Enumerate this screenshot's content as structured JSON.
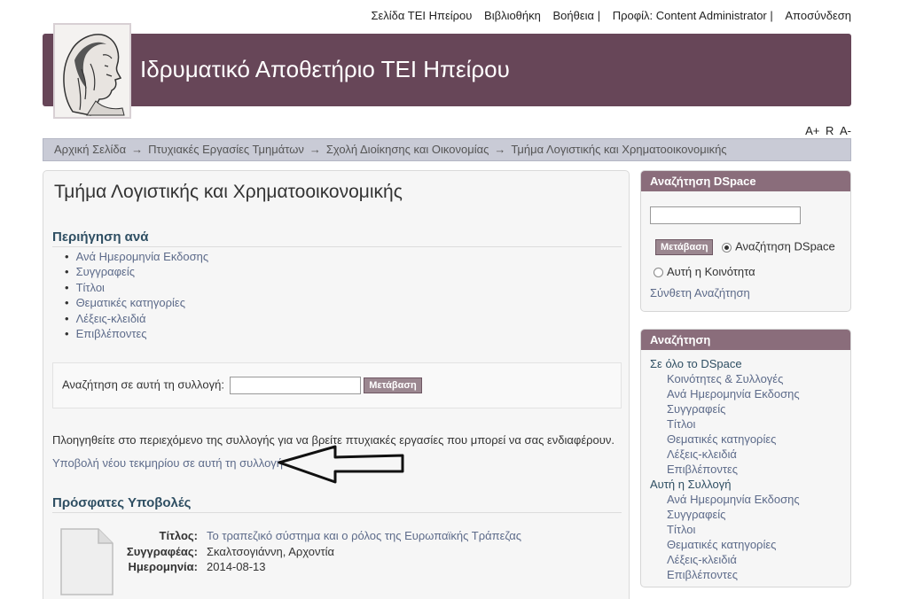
{
  "topnav": {
    "home": "Σελίδα ΤΕΙ Ηπείρου",
    "library": "Βιβλιοθήκη",
    "help": "Βοήθεια |",
    "profile": "Προφίλ: Content Administrator |",
    "logout": "Αποσύνδεση"
  },
  "banner": {
    "title": "Ιδρυματικό Αποθετήριο ΤΕΙ Ηπείρου"
  },
  "font_size": {
    "increase": "A+",
    "reset": "R",
    "decrease": "A-"
  },
  "breadcrumb": {
    "items": [
      "Αρχική Σελίδα",
      "Πτυχιακές Εργασίες Τμημάτων",
      "Σχολή Διοίκησης και Οικονομίας",
      "Τμήμα Λογιστικής και Χρηματοοικονομικής"
    ],
    "separator": "→"
  },
  "main": {
    "title": "Τμήμα Λογιστικής και Χρηματοοικονομικής",
    "browse_heading": "Περιήγηση ανά",
    "browse_items": [
      "Ανά Ημερομηνία Εκδοσης",
      "Συγγραφείς",
      "Τίτλοι",
      "Θεματικές κατηγορίες",
      "Λέξεις-κλειδιά",
      "Επιβλέποντες"
    ],
    "collection_search_label": "Αναζήτηση σε αυτή τη συλλογή:",
    "collection_search_value": "",
    "go_label": "Μετάβαση",
    "info_text": "Πλοηγηθείτε στο περιεχόμενο της συλλογής για να βρείτε πτυχιακές εργασίες που μπορεί να σας ενδιαφέρουν.",
    "submit_link": "Υποβολή νέου τεκμηρίου σε αυτή τη συλλογή",
    "recent_heading": "Πρόσφατες Υποβολές",
    "recent_item": {
      "title_label": "Τίτλος:",
      "title": "Το τραπεζικό σύστημα και ο ρόλος της Ευρωπαϊκής Τράπεζας",
      "author_label": "Συγγραφέας:",
      "author": "Σκαλτσογιάννη, Αρχοντία",
      "date_label": "Ημερομηνία:",
      "date": "2014-08-13"
    }
  },
  "sidebar": {
    "search_box": {
      "heading": "Αναζήτηση DSpace",
      "input_value": "",
      "go_label": "Μετάβαση",
      "option_all": "Αναζήτηση DSpace",
      "option_community": "Αυτή η Κοινότητα",
      "advanced": "Σύνθετη Αναζήτηση"
    },
    "browse_box": {
      "heading": "Αναζήτηση",
      "all_heading": "Σε όλο το DSpace",
      "all_items": [
        "Κοινότητες & Συλλογές",
        "Ανά Ημερομηνία Εκδοσης",
        "Συγγραφείς",
        "Τίτλοι",
        "Θεματικές κατηγορίες",
        "Λέξεις-κλειδιά",
        "Επιβλέποντες"
      ],
      "coll_heading": "Αυτή η Συλλογή",
      "coll_items": [
        "Ανά Ημερομηνία Εκδοσης",
        "Συγγραφείς",
        "Τίτλοι",
        "Θεματικές κατηγορίες",
        "Λέξεις-κλειδιά",
        "Επιβλέποντες"
      ]
    }
  },
  "colors": {
    "banner": "#674658",
    "box_header": "#8a6d7b",
    "link": "#5d6b8a"
  }
}
